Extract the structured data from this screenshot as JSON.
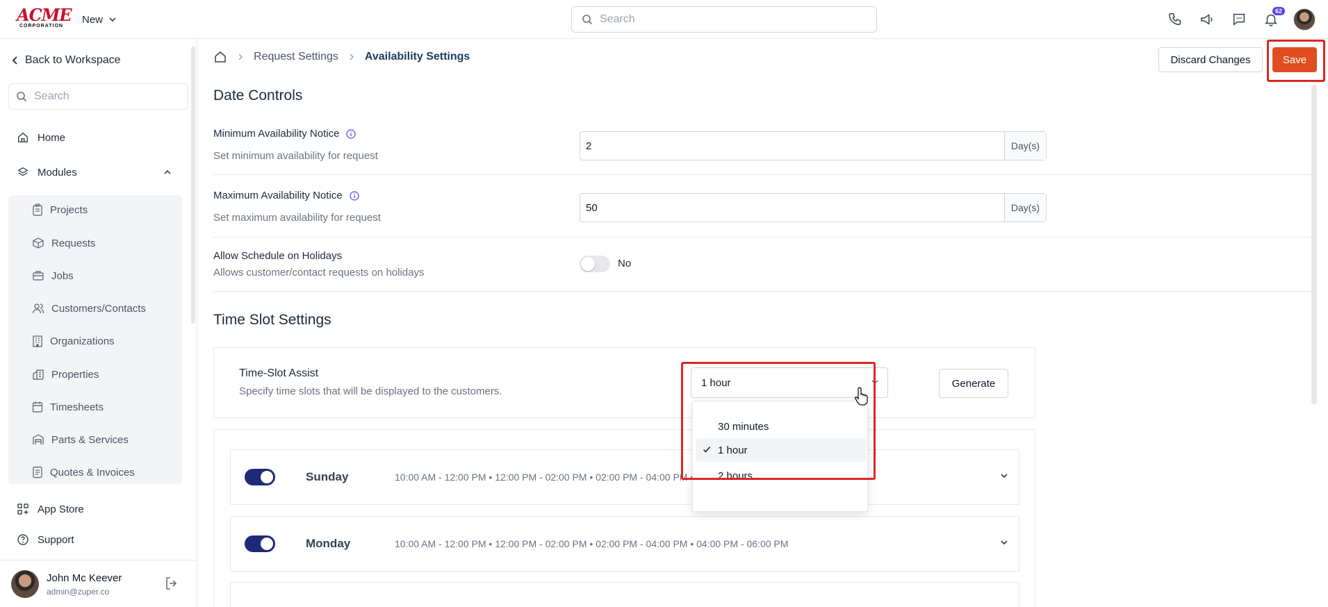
{
  "brand": {
    "logo_top": "ACME",
    "logo_bottom": "CORPORATION"
  },
  "topbar": {
    "new_label": "New",
    "search_placeholder": "Search",
    "notification_count": "62",
    "icons": [
      "phone-icon",
      "megaphone-icon",
      "chat-icon",
      "bell-icon"
    ]
  },
  "sidebar": {
    "back_label": "Back to Workspace",
    "search_placeholder": "Search",
    "home_label": "Home",
    "modules_label": "Modules",
    "modules": [
      {
        "label": "Projects",
        "icon": "clipboard-icon"
      },
      {
        "label": "Requests",
        "icon": "box-icon"
      },
      {
        "label": "Jobs",
        "icon": "briefcase-icon"
      },
      {
        "label": "Customers/Contacts",
        "icon": "users-icon"
      },
      {
        "label": "Organizations",
        "icon": "building-icon"
      },
      {
        "label": "Properties",
        "icon": "property-icon"
      },
      {
        "label": "Timesheets",
        "icon": "calendar-icon"
      },
      {
        "label": "Parts & Services",
        "icon": "warehouse-icon"
      },
      {
        "label": "Quotes & Invoices",
        "icon": "document-icon"
      }
    ],
    "app_store_label": "App Store",
    "support_label": "Support",
    "user": {
      "name": "John Mc Keever",
      "email": "admin@zuper.co"
    }
  },
  "header": {
    "breadcrumb": [
      "Request Settings",
      "Availability Settings"
    ],
    "discard_label": "Discard Changes",
    "save_label": "Save"
  },
  "date_controls": {
    "title": "Date Controls",
    "min_notice": {
      "label": "Minimum Availability Notice",
      "sub": "Set minimum availability for request",
      "value": "2",
      "unit": "Day(s)"
    },
    "max_notice": {
      "label": "Maximum Availability Notice",
      "sub": "Set maximum availability for request",
      "value": "50",
      "unit": "Day(s)"
    },
    "holidays": {
      "label": "Allow Schedule on Holidays",
      "sub": "Allows customer/contact requests on holidays",
      "state": "No"
    }
  },
  "time_slots": {
    "title": "Time Slot Settings",
    "assist_title": "Time-Slot Assist",
    "assist_sub": "Specify time slots that will be displayed to the customers.",
    "selected": "1 hour",
    "options": [
      "30 minutes",
      "1 hour",
      "2 hours"
    ],
    "generate_label": "Generate",
    "days": [
      {
        "name": "Sunday",
        "slots": "10:00 AM - 12:00 PM • 12:00 PM - 02:00 PM • 02:00 PM - 04:00 PM • 04:00 PM - 06:00 PM"
      },
      {
        "name": "Monday",
        "slots": "10:00 AM - 12:00 PM • 12:00 PM - 02:00 PM • 02:00 PM - 04:00 PM • 04:00 PM - 06:00 PM"
      }
    ]
  },
  "colors": {
    "accent": "#e04e1f",
    "toggle_on": "#1e2a78",
    "highlight": "#dc2626"
  }
}
